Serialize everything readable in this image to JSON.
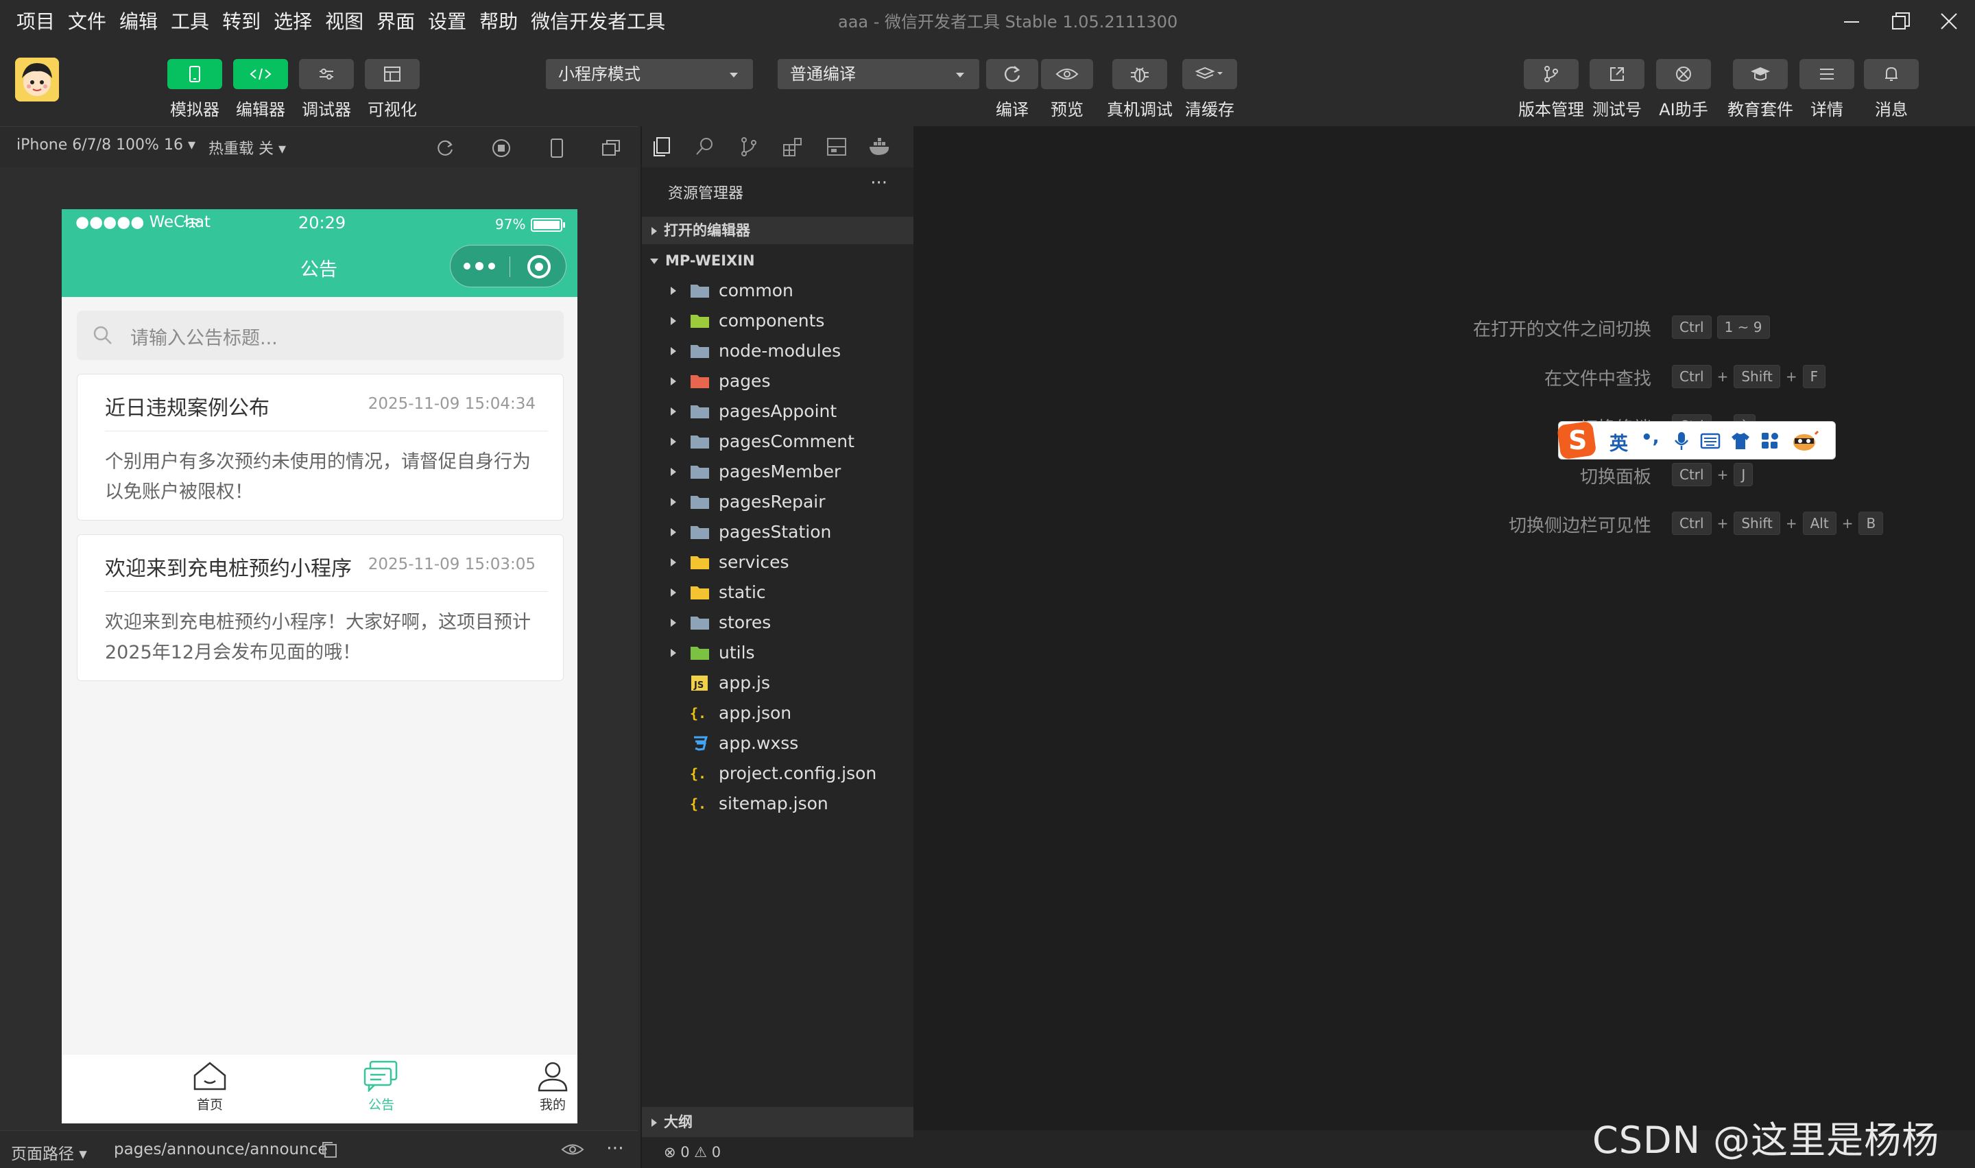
{
  "menu": [
    "项目",
    "文件",
    "编辑",
    "工具",
    "转到",
    "选择",
    "视图",
    "界面",
    "设置",
    "帮助",
    "微信开发者工具"
  ],
  "window_title": "aaa - 微信开发者工具 Stable 1.05.2111300",
  "toolbar": {
    "simulator": "模拟器",
    "editor": "编辑器",
    "debugger": "调试器",
    "visual": "可视化",
    "mode_select": "小程序模式",
    "compile_select": "普通编译",
    "compile": "编译",
    "preview": "预览",
    "remote_debug": "真机调试",
    "clear_cache": "清缓存",
    "version": "版本管理",
    "test_account": "测试号",
    "ai": "AI助手",
    "edu": "教育套件",
    "details": "详情",
    "messages": "消息"
  },
  "simbar": {
    "device": "iPhone 6/7/8 100% 16",
    "hot_reload": "热重载 关"
  },
  "phone": {
    "carrier": "●●●●● WeChat",
    "time": "20:29",
    "battery": "97%",
    "page_title": "公告",
    "search_placeholder": "请输入公告标题...",
    "announcements": [
      {
        "title": "近日违规案例公布",
        "date": "2025-11-09 15:04:34",
        "body": "个别用户有多次预约未使用的情况，请督促自身行为以免账户被限权！"
      },
      {
        "title": "欢迎来到充电桩预约小程序",
        "date": "2025-11-09 15:03:05",
        "body": "欢迎来到充电桩预约小程序！大家好啊，这项目预计2025年12月会发布见面的哦！"
      }
    ],
    "tabs": [
      "首页",
      "公告",
      "我的"
    ]
  },
  "simfoot": {
    "path_label": "页面路径",
    "path": "pages/announce/announce"
  },
  "explorer": {
    "header": "资源管理器",
    "more": "···",
    "open_editors": "打开的编辑器",
    "project": "MP-WEIXIN",
    "items": [
      {
        "name": "common",
        "type": "folder",
        "color": "#8fa3b8"
      },
      {
        "name": "components",
        "type": "folder",
        "color": "#9ccc3c"
      },
      {
        "name": "node-modules",
        "type": "folder",
        "color": "#8fa3b8"
      },
      {
        "name": "pages",
        "type": "folder",
        "color": "#e8664d"
      },
      {
        "name": "pagesAppoint",
        "type": "folder",
        "color": "#8fa3b8"
      },
      {
        "name": "pagesComment",
        "type": "folder",
        "color": "#8fa3b8"
      },
      {
        "name": "pagesMember",
        "type": "folder",
        "color": "#8fa3b8"
      },
      {
        "name": "pagesRepair",
        "type": "folder",
        "color": "#8fa3b8"
      },
      {
        "name": "pagesStation",
        "type": "folder",
        "color": "#8fa3b8"
      },
      {
        "name": "services",
        "type": "folder",
        "color": "#f4c430"
      },
      {
        "name": "static",
        "type": "folder",
        "color": "#f4c430"
      },
      {
        "name": "stores",
        "type": "folder",
        "color": "#8fa3b8"
      },
      {
        "name": "utils",
        "type": "folder",
        "color": "#7cc242"
      },
      {
        "name": "app.js",
        "type": "js",
        "color": "#f1d04a"
      },
      {
        "name": "app.json",
        "type": "json",
        "color": "#f1c40f"
      },
      {
        "name": "app.wxss",
        "type": "css",
        "color": "#42a5f5"
      },
      {
        "name": "project.config.json",
        "type": "json",
        "color": "#f1c40f"
      },
      {
        "name": "sitemap.json",
        "type": "json",
        "color": "#f1c40f"
      }
    ],
    "outline": "大纲",
    "status": "⊗ 0 ⚠ 0"
  },
  "shortcuts": [
    {
      "label": "在打开的文件之间切换",
      "keys": [
        "Ctrl",
        "1 ~ 9"
      ]
    },
    {
      "label": "在文件中查找",
      "keys": [
        "Ctrl",
        "+",
        "Shift",
        "+",
        "F"
      ]
    },
    {
      "label": "切换终端",
      "keys": [
        "Ctrl",
        "+",
        "`"
      ]
    },
    {
      "label": "切换面板",
      "keys": [
        "Ctrl",
        "+",
        "J"
      ]
    },
    {
      "label": "切换侧边栏可见性",
      "keys": [
        "Ctrl",
        "+",
        "Shift",
        "+",
        "Alt",
        "+",
        "B"
      ]
    }
  ],
  "ime": {
    "lang": "英",
    "punct": "•,"
  },
  "watermark": "CSDN @这里是杨杨吖",
  "colors": {
    "accent": "#35c59b",
    "green_btn": "#07c160"
  }
}
